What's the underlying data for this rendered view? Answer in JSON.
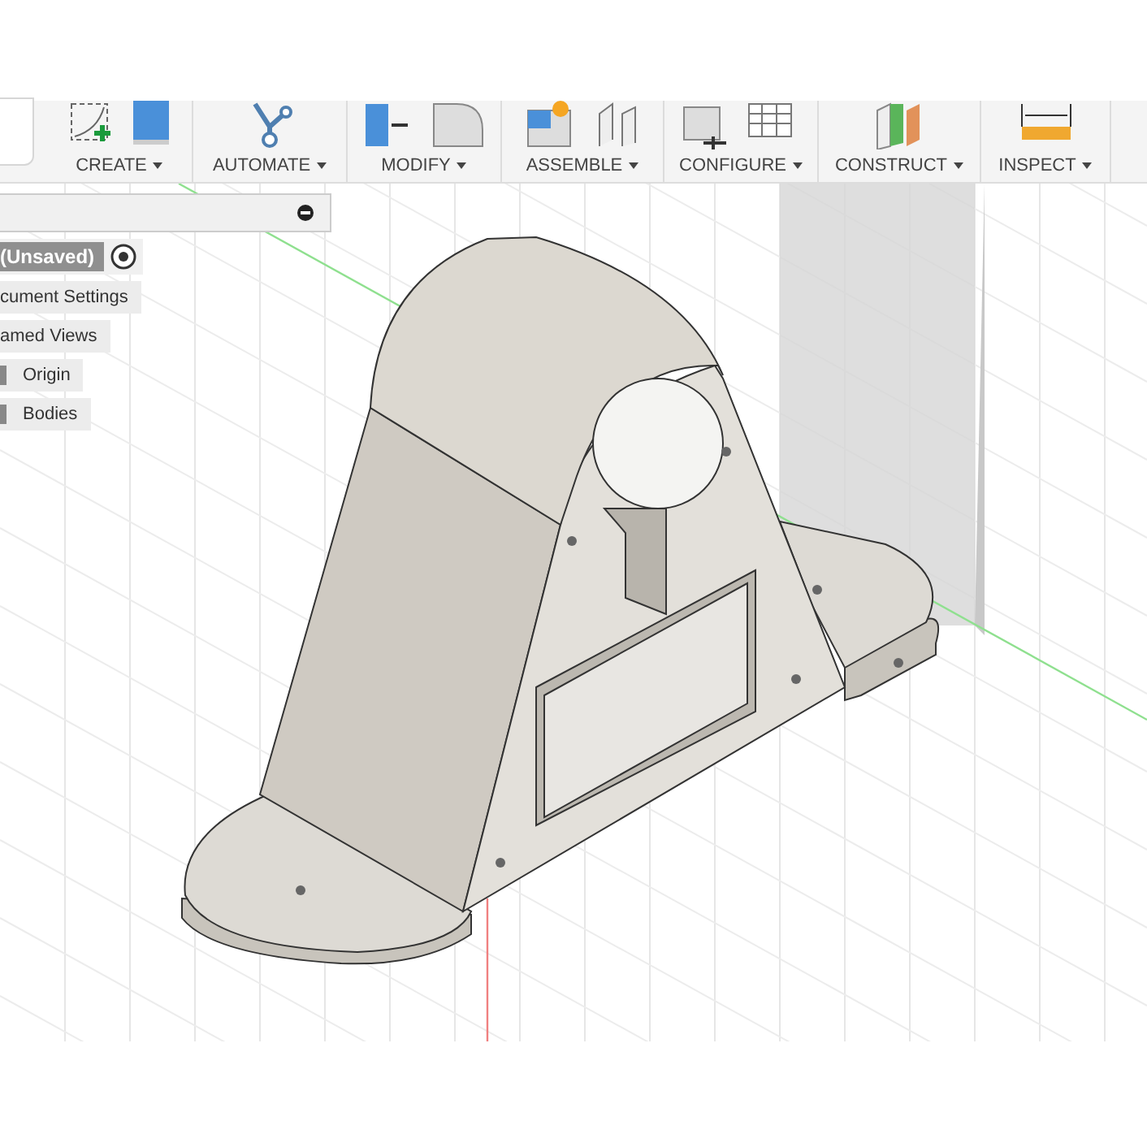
{
  "toolbar": {
    "groups": [
      {
        "label": "CREATE",
        "kind": "create"
      },
      {
        "label": "AUTOMATE",
        "kind": "automate"
      },
      {
        "label": "MODIFY",
        "kind": "modify"
      },
      {
        "label": "ASSEMBLE",
        "kind": "assemble"
      },
      {
        "label": "CONFIGURE",
        "kind": "configure"
      },
      {
        "label": "CONSTRUCT",
        "kind": "construct"
      },
      {
        "label": "INSPECT",
        "kind": "inspect"
      }
    ]
  },
  "browser": {
    "root": "(Unsaved)",
    "items": [
      {
        "label": "cument Settings",
        "kind": "plain"
      },
      {
        "label": "amed Views",
        "kind": "plain"
      },
      {
        "label": "Origin",
        "kind": "folder"
      },
      {
        "label": "Bodies",
        "kind": "folder"
      }
    ]
  }
}
